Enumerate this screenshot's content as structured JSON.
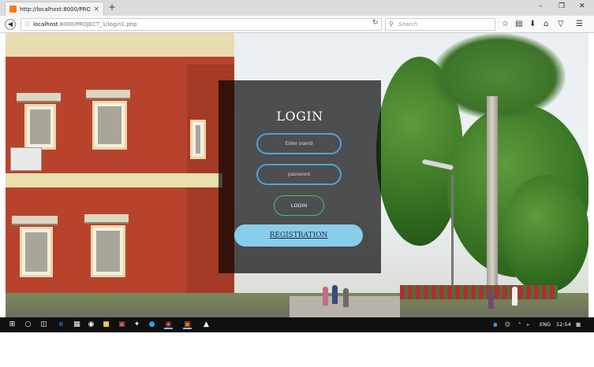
{
  "browser": {
    "tab_title": "http://localhost:8000/PROJE",
    "tab_close": "×",
    "new_tab": "+",
    "url_host": "localhost",
    "url_path": ":8000/PROJECT_1/login1.php",
    "search_placeholder": "Search",
    "window_controls": {
      "minimize": "–",
      "maximize": "❐",
      "close": "✕"
    },
    "toolbar_icons": [
      "star-icon",
      "reader-icon",
      "download-icon",
      "home-icon",
      "pocket-icon",
      "menu-icon"
    ]
  },
  "login": {
    "title": "LOGIN",
    "userid_placeholder": "Enter userid",
    "password_placeholder": "password",
    "login_label": "LOGIN",
    "registration_label": "REGISTRATION"
  },
  "taskbar": {
    "apps": [
      "windows-start-icon",
      "cortana-icon",
      "task-view-icon",
      "edge-icon",
      "app-icon",
      "hp-icon",
      "file-explorer-icon",
      "app2-icon",
      "app3-icon",
      "app4-icon",
      "chrome-icon",
      "firefox-icon",
      "app5-icon",
      "photos-icon"
    ],
    "language": "ENG",
    "time": "12:54"
  },
  "colors": {
    "field_border": "#4fa3d9",
    "login_border": "#3fc46a",
    "registration_bg": "#87ceeb",
    "card_bg": "rgba(0,0,0,0.68)"
  }
}
